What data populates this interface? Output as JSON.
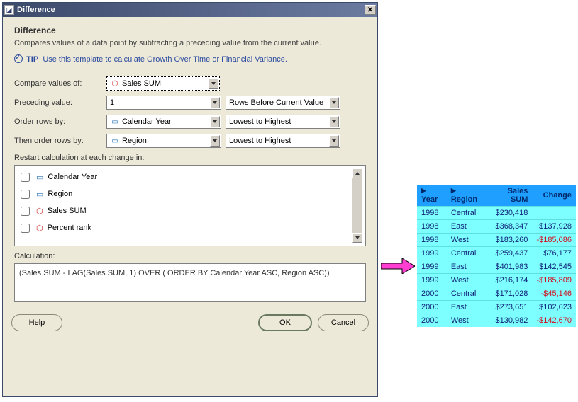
{
  "dialog": {
    "title": "Difference",
    "heading": "Difference",
    "description": "Compares values of a data point by subtracting a preceding value from the current value.",
    "tip_label": "TIP",
    "tip_text": "Use this template to calculate Growth Over Time or Financial Variance.",
    "labels": {
      "compare": "Compare values of:",
      "preceding": "Preceding value:",
      "order": "Order rows by:",
      "then_order": "Then order rows by:",
      "restart": "Restart calculation at each change in:",
      "calculation": "Calculation:"
    },
    "fields": {
      "compare_value": "Sales SUM",
      "preceding_value": "1",
      "preceding_mode": "Rows Before Current Value",
      "order_by": "Calendar Year",
      "order_dir": "Lowest to Highest",
      "then_by": "Region",
      "then_dir": "Lowest to Highest"
    },
    "restart_items": [
      {
        "label": "Calendar Year",
        "checked": false,
        "icon": "dim"
      },
      {
        "label": "Region",
        "checked": false,
        "icon": "dim"
      },
      {
        "label": "Sales SUM",
        "checked": false,
        "icon": "measure"
      },
      {
        "label": "Percent rank",
        "checked": false,
        "icon": "measure"
      }
    ],
    "calculation_text": "(Sales SUM - LAG(Sales SUM, 1) OVER ( ORDER BY Calendar Year ASC, Region ASC))",
    "buttons": {
      "help": "Help",
      "ok": "OK",
      "cancel": "Cancel"
    }
  },
  "result": {
    "headers": [
      "Year",
      "Region",
      "Sales SUM",
      "Change"
    ],
    "rows": [
      {
        "year": "1998",
        "region": "Central",
        "sales": "$230,418",
        "change": ""
      },
      {
        "year": "1998",
        "region": "East",
        "sales": "$368,347",
        "change": "$137,928"
      },
      {
        "year": "1998",
        "region": "West",
        "sales": "$183,260",
        "change": "-$185,086",
        "neg": true
      },
      {
        "year": "1999",
        "region": "Central",
        "sales": "$259,437",
        "change": "$76,177"
      },
      {
        "year": "1999",
        "region": "East",
        "sales": "$401,983",
        "change": "$142,545"
      },
      {
        "year": "1999",
        "region": "West",
        "sales": "$216,174",
        "change": "-$185,809",
        "neg": true
      },
      {
        "year": "2000",
        "region": "Central",
        "sales": "$171,028",
        "change": "-$45,146",
        "neg": true
      },
      {
        "year": "2000",
        "region": "East",
        "sales": "$273,651",
        "change": "$102,623"
      },
      {
        "year": "2000",
        "region": "West",
        "sales": "$130,982",
        "change": "-$142,670",
        "neg": true
      }
    ]
  }
}
